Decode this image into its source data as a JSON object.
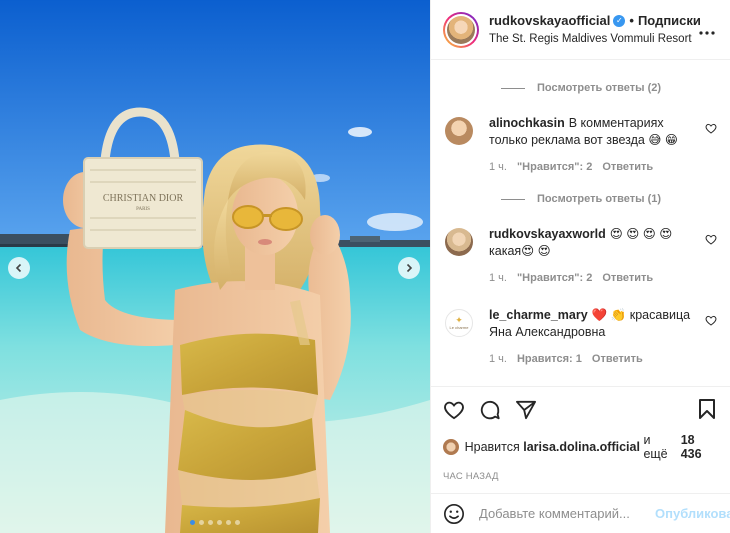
{
  "post": {
    "author": "rudkovskayaofficial",
    "follow_label": "Подписки",
    "location": "The St. Regis Maldives Vommuli Resort",
    "separator": "•",
    "more_icon": "more-horizontal-icon",
    "bag_text": "CHRISTIAN DIOR",
    "bag_subtext": "PARIS"
  },
  "carousel": {
    "total": 6,
    "active_index": 0
  },
  "comments": [
    {
      "user": "alinochkasin",
      "text": "В комментариях только реклама вот звезда 😅 😁",
      "time": "1 ч.",
      "likes": "\"Нравится\": 2",
      "reply": "Ответить"
    },
    {
      "user": "rudkovskayaxworld",
      "text": "😍 😍 😍 😍 какая😍 😍",
      "time": "1 ч.",
      "likes": "\"Нравится\": 2",
      "reply": "Ответить"
    },
    {
      "user": "le_charme_mary",
      "text": "❤️ 👏 красавица Яна Александровна",
      "time": "1 ч.",
      "likes": "Нравится: 1",
      "reply": "Ответить",
      "avatar_text": "Le charme"
    }
  ],
  "replies": [
    {
      "label": "Посмотреть ответы (2)"
    },
    {
      "label": "Посмотреть ответы (1)"
    }
  ],
  "likes": {
    "prefix": "Нравится",
    "user": "larisa.dolina.official",
    "middle": "и ещё",
    "count": "18 436"
  },
  "time_ago": "ЧАС НАЗАД",
  "comment_box": {
    "placeholder": "Добавьте комментарий...",
    "publish_label": "Опубликовать"
  },
  "colors": {
    "accent": "#3897f0",
    "publish_disabled": "#b2dffc",
    "muted": "#8e8e8e"
  }
}
